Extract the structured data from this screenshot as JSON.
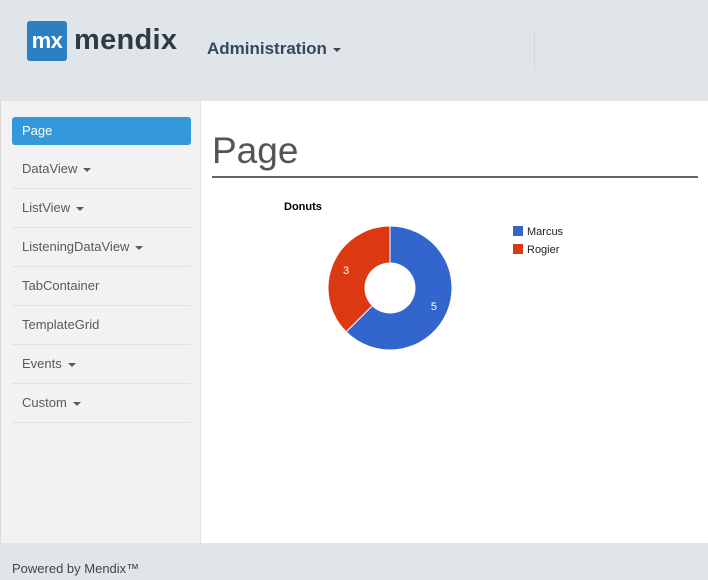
{
  "header": {
    "logo_mark": "mx",
    "logo_text": "mendix",
    "menu_label": "Administration"
  },
  "sidebar": {
    "items": [
      {
        "label": "Page",
        "active": true,
        "has_dropdown": false
      },
      {
        "label": "DataView",
        "active": false,
        "has_dropdown": true
      },
      {
        "label": "ListView",
        "active": false,
        "has_dropdown": true
      },
      {
        "label": "ListeningDataView",
        "active": false,
        "has_dropdown": true
      },
      {
        "label": "TabContainer",
        "active": false,
        "has_dropdown": false
      },
      {
        "label": "TemplateGrid",
        "active": false,
        "has_dropdown": false
      },
      {
        "label": "Events",
        "active": false,
        "has_dropdown": true
      },
      {
        "label": "Custom",
        "active": false,
        "has_dropdown": true
      }
    ]
  },
  "main": {
    "page_title": "Page"
  },
  "chart_data": {
    "type": "pie",
    "donut": true,
    "title": "Donuts",
    "slices": [
      {
        "label": "Marcus",
        "value": 5,
        "color": "#3366cc"
      },
      {
        "label": "Rogier",
        "value": 3,
        "color": "#dc3912"
      }
    ],
    "legend": "right"
  },
  "footer": {
    "text": "Powered by Mendix™"
  },
  "colors": {
    "accent": "#3498db",
    "logo": "#2c7fc0",
    "header_bg": "#e0e5ea"
  }
}
